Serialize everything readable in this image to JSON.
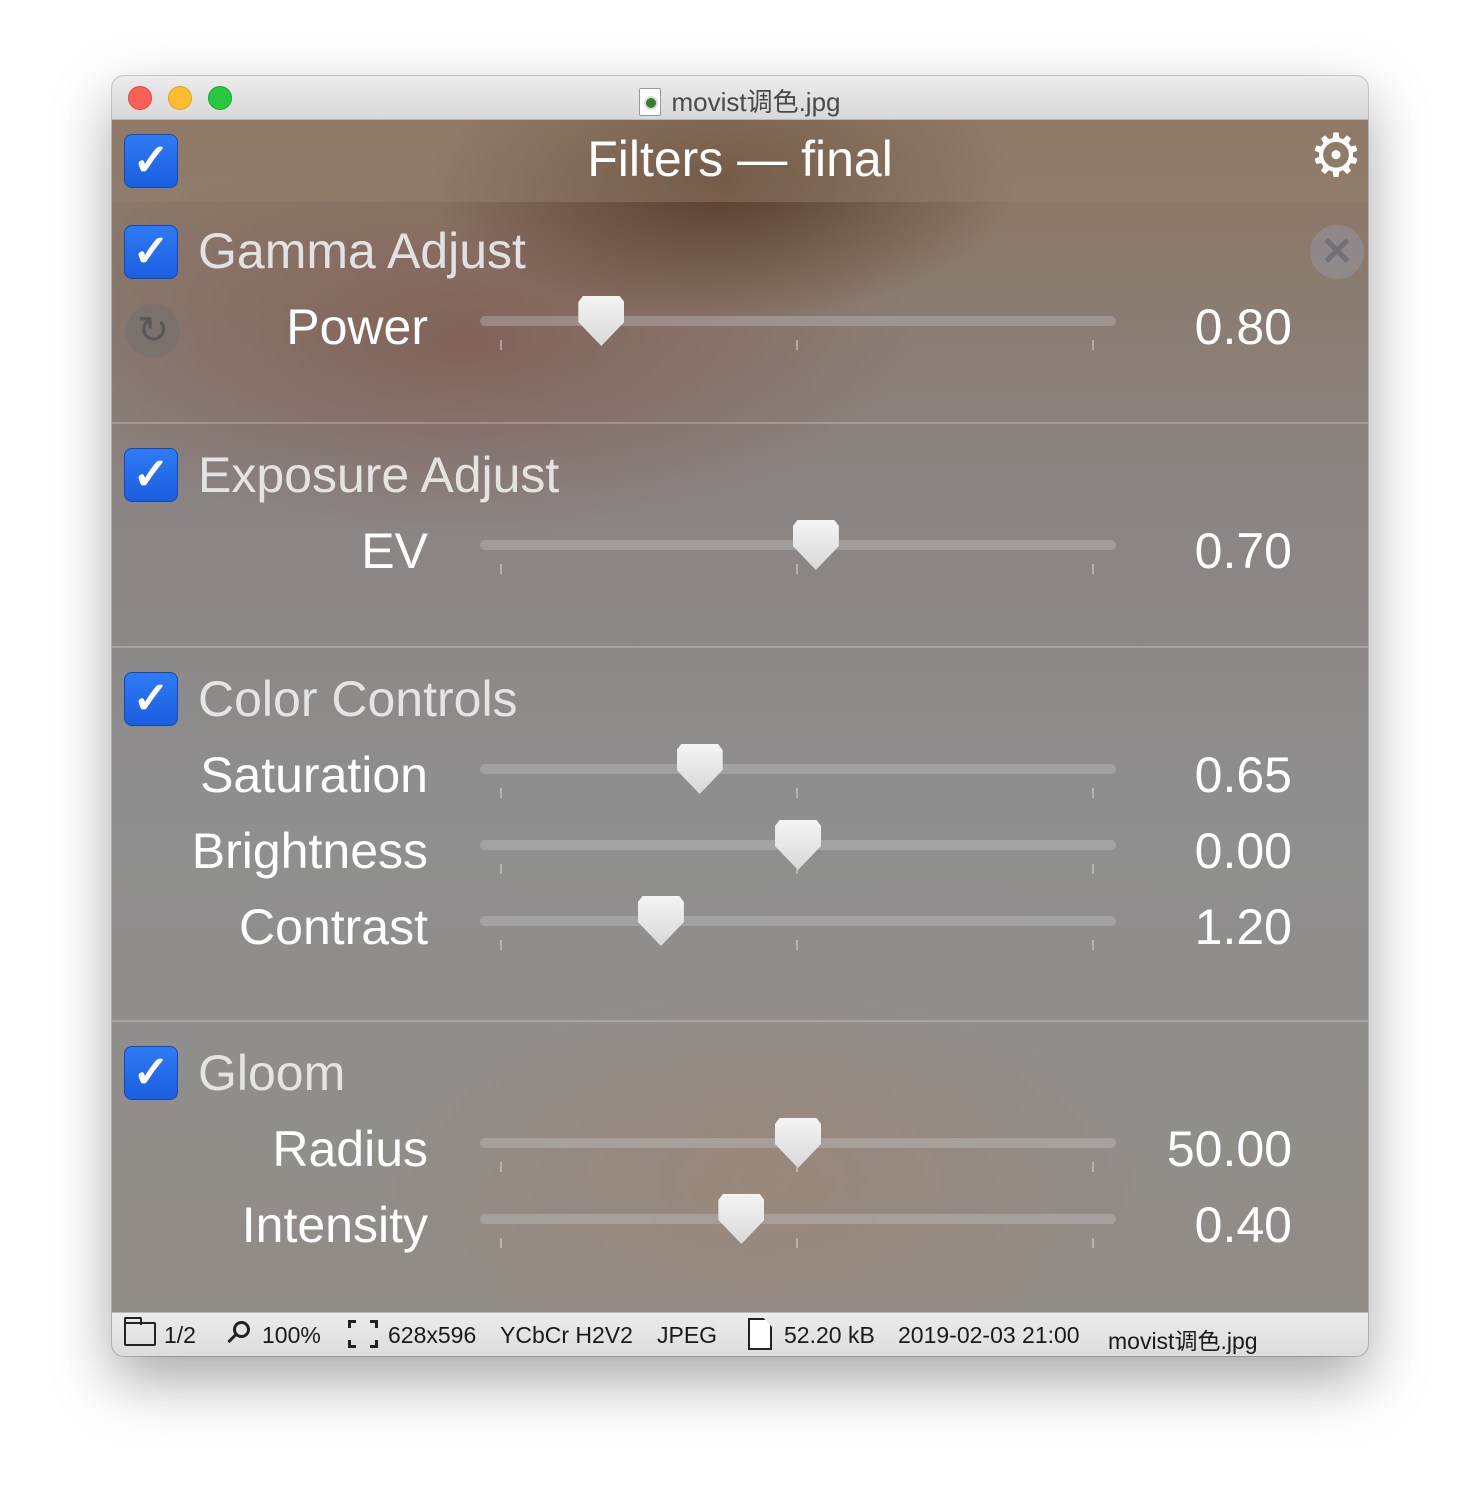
{
  "window": {
    "title": "movist调色.jpg",
    "controls": [
      "close",
      "minimize",
      "zoom"
    ]
  },
  "panel": {
    "title": "Filters — final",
    "master_enabled": true,
    "settings_icon": "gear-icon"
  },
  "filters": [
    {
      "name": "Gamma Adjust",
      "enabled": true,
      "params": [
        {
          "label": "Power",
          "value": "0.80",
          "fraction": 0.17
        }
      ]
    },
    {
      "name": "Exposure Adjust",
      "enabled": true,
      "params": [
        {
          "label": "EV",
          "value": "0.70",
          "fraction": 0.53
        }
      ]
    },
    {
      "name": "Color Controls",
      "enabled": true,
      "params": [
        {
          "label": "Saturation",
          "value": "0.65",
          "fraction": 0.335
        },
        {
          "label": "Brightness",
          "value": "0.00",
          "fraction": 0.5
        },
        {
          "label": "Contrast",
          "value": "1.20",
          "fraction": 0.27
        }
      ]
    },
    {
      "name": "Gloom",
      "enabled": true,
      "params": [
        {
          "label": "Radius",
          "value": "50.00",
          "fraction": 0.5
        },
        {
          "label": "Intensity",
          "value": "0.40",
          "fraction": 0.405
        }
      ]
    }
  ],
  "status": {
    "page": "1/2",
    "zoom": "100%",
    "dimensions": "628x596",
    "color_space": "YCbCr H2V2",
    "format": "JPEG",
    "file_size": "52.20 kB",
    "date": "2019-02-03 21:00",
    "filename": "movist调色.jpg"
  },
  "colors": {
    "accent": "#1f6aed",
    "close": "#fe5f57",
    "minimize": "#febc2e",
    "zoom": "#28c840"
  }
}
